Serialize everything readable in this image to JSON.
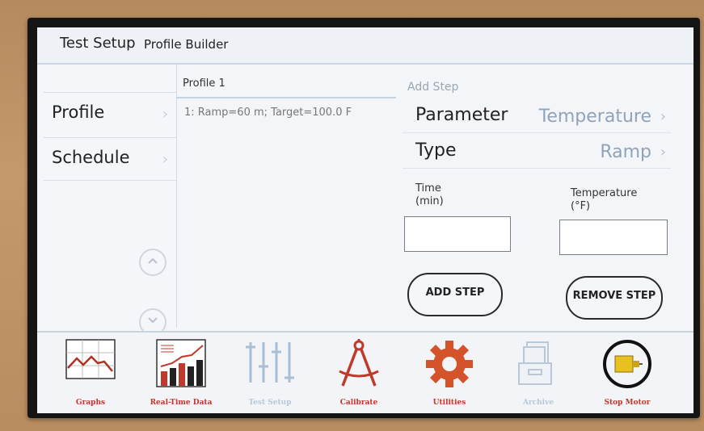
{
  "header": {
    "title": "Test Setup",
    "subtitle": "Profile Builder"
  },
  "sidebar": {
    "items": [
      {
        "label": "Profile",
        "chevron": "›"
      },
      {
        "label": "Schedule",
        "chevron": "›"
      }
    ],
    "scroll_up_icon": "chevron-up",
    "scroll_down_icon": "chevron-down"
  },
  "profile": {
    "title": "Profile 1",
    "steps": [
      "1: Ramp=60 m; Target=100.0 F"
    ]
  },
  "add_step": {
    "title": "Add Step",
    "parameter": {
      "label": "Parameter",
      "value": "Temperature",
      "chevron": "›"
    },
    "type": {
      "label": "Type",
      "value": "Ramp",
      "chevron": "›"
    },
    "time_label_line1": "Time",
    "time_label_line2": "(min)",
    "temp_label_line1": "Temperature",
    "temp_label_line2": "(°F)",
    "time_value": "",
    "temp_value": "",
    "add_button": "ADD STEP",
    "remove_button": "REMOVE STEP"
  },
  "toolbar": {
    "items": [
      {
        "label": "Graphs",
        "icon": "line-graph-icon",
        "enabled": true
      },
      {
        "label": "Real-Time Data",
        "icon": "bar-chart-icon",
        "enabled": true
      },
      {
        "label": "Test Setup",
        "icon": "sliders-icon",
        "enabled": false
      },
      {
        "label": "Calibrate",
        "icon": "compass-icon",
        "enabled": true
      },
      {
        "label": "Utilities",
        "icon": "gear-icon",
        "enabled": true
      },
      {
        "label": "Archive",
        "icon": "archive-icon",
        "enabled": false
      },
      {
        "label": "Stop Motor",
        "icon": "motor-icon",
        "enabled": true
      }
    ]
  },
  "colors": {
    "accent_red": "#c0392b",
    "disabled_blue": "#b9c7d6",
    "gear_orange": "#d4532a",
    "motor_yellow": "#e8c020",
    "value_blue": "#8fa4ba"
  }
}
